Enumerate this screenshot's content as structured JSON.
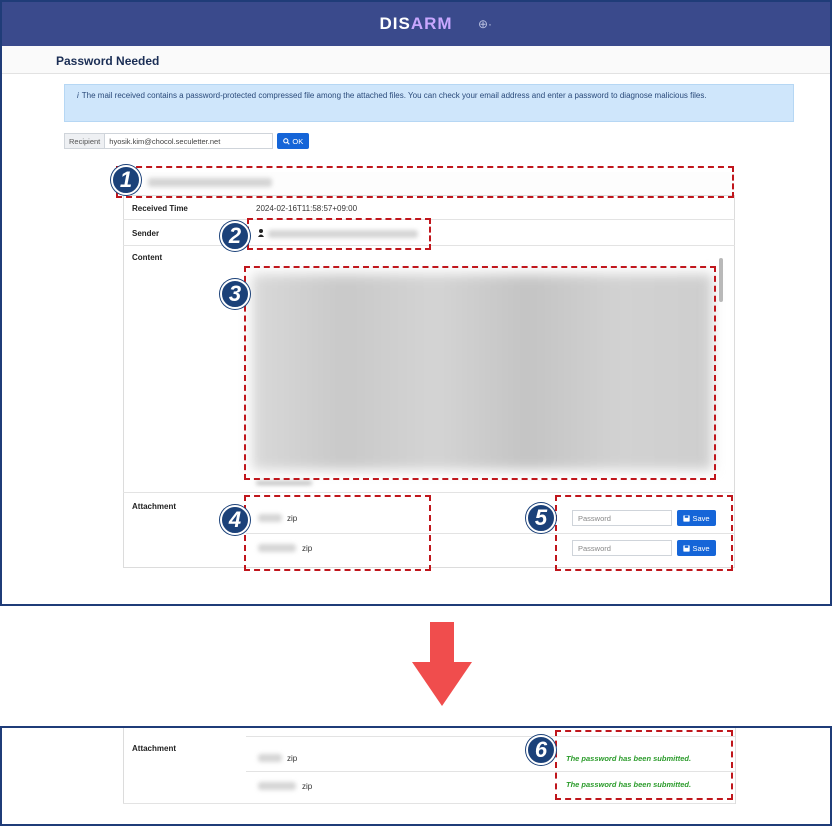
{
  "app": {
    "logo_left": "DIS",
    "logo_right": "ARM",
    "globe_icon": "globe-icon",
    "page_title": "Password Needed"
  },
  "notice": {
    "text": "The mail received contains a password-protected compressed file among the attached files. You can check your email address and enter a password to diagnose malicious files."
  },
  "recipient": {
    "label": "Recipient",
    "value": "hyosik.kim@chocol.seculetter.net",
    "ok_label": "OK"
  },
  "mail": {
    "received_time_label": "Received Time",
    "received_time": "2024-02-16T11:58:57+09:00",
    "sender_label": "Sender",
    "content_label": "Content",
    "attachment_label": "Attachment"
  },
  "attachments": [
    {
      "ext": "zip",
      "password_placeholder": "Password",
      "save_label": "Save",
      "submitted_message": "The password has been submitted."
    },
    {
      "ext": "zip",
      "password_placeholder": "Password",
      "save_label": "Save",
      "submitted_message": "The password has been submitted."
    }
  ],
  "badges": [
    "1",
    "2",
    "3",
    "4",
    "5",
    "6"
  ],
  "colors": {
    "topbar": "#3a4a8c",
    "annotation": "#c0161c",
    "badge": "#1b4179",
    "arrow": "#f04d4d",
    "success": "#2a9b2a",
    "primary_button": "#1565d8"
  }
}
